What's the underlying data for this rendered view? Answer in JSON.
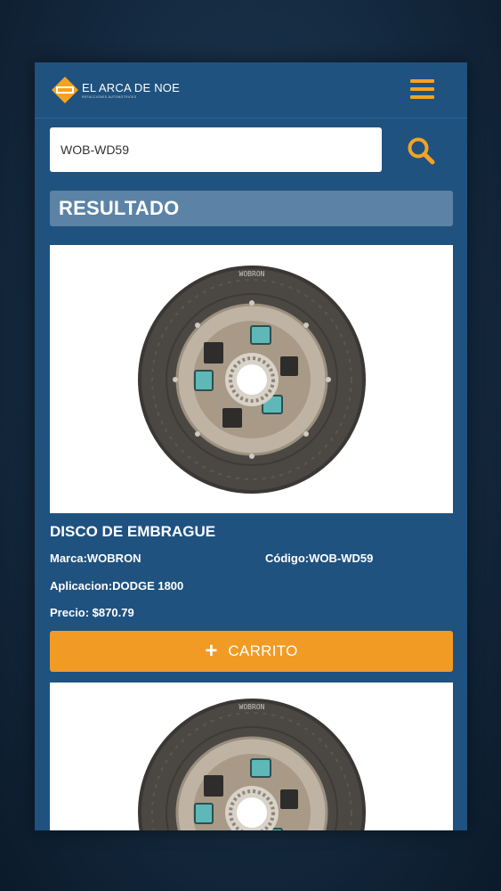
{
  "header": {
    "logo_title": "EL ARCA DE NOE",
    "logo_subtitle": "REFACCIONES AUTOMOTRICES"
  },
  "search": {
    "value": "WOB-WD59"
  },
  "results": {
    "heading": "RESULTADO"
  },
  "product": {
    "name": "DISCO DE EMBRAGUE",
    "marca": "Marca:WOBRON",
    "codigo": "Código:WOB-WD59",
    "aplicacion": "Aplicacion:DODGE 1800",
    "precio": "Precio: $870.79",
    "cart_label": "CARRITO",
    "disc_text": "WOBRON"
  },
  "colors": {
    "accent": "#f19b25",
    "panel": "#1f527f",
    "result_bar": "#5c83a5"
  },
  "icons": {
    "menu": "hamburger-icon",
    "search": "search-icon",
    "cart_add": "plus-icon"
  }
}
